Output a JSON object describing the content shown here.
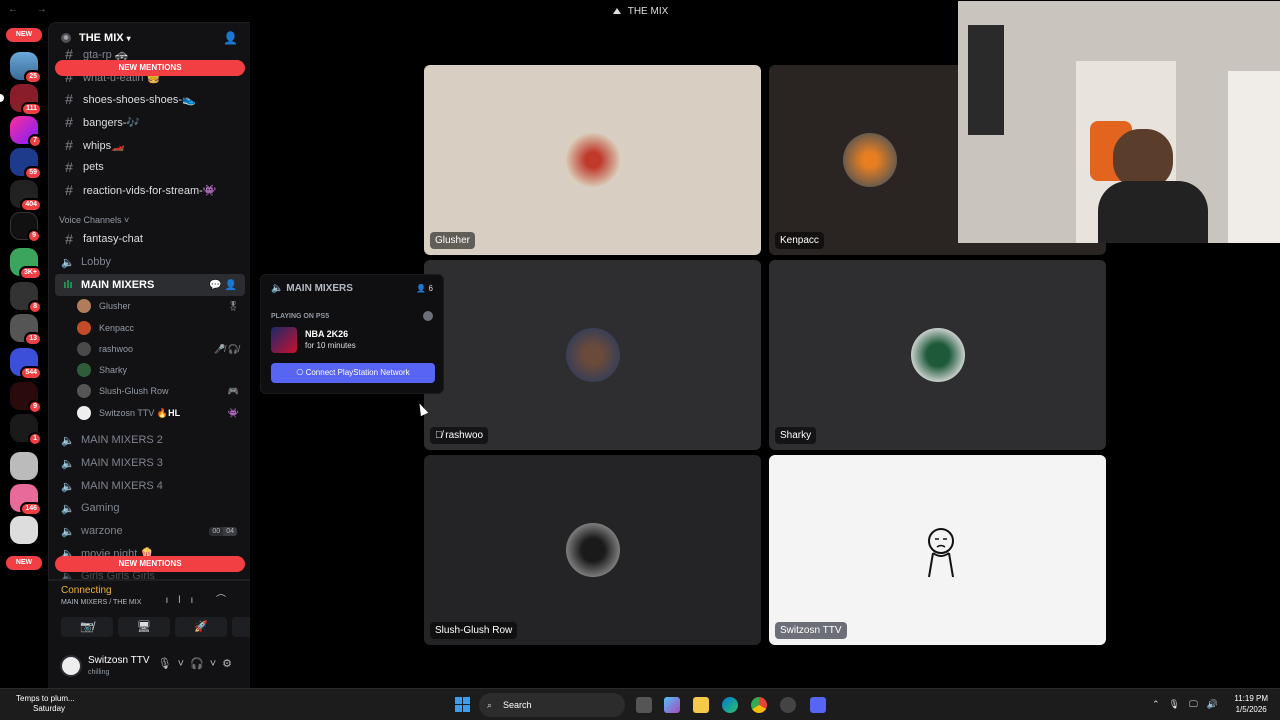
{
  "window": {
    "title": "THE MIX",
    "nav": "← →"
  },
  "rail": {
    "new_top": "NEW",
    "new_bottom": "NEW",
    "badges": [
      "25",
      "111",
      "7",
      "59",
      "404",
      "9",
      "3K+",
      "8",
      "13",
      "544",
      "9",
      "1",
      "146"
    ]
  },
  "sidebar": {
    "guild_name": "THE MIX",
    "mention_top": "NEW MENTIONS",
    "mention_bottom": "NEW MENTIONS",
    "text_channels": [
      {
        "name": "gta-rp 🚓"
      },
      {
        "name": "what-u-eatin 🍔"
      },
      {
        "name": "shoes-shoes-shoes-👟"
      },
      {
        "name": "bangers-🎶"
      },
      {
        "name": "whips🏎️"
      },
      {
        "name": "pets"
      },
      {
        "name": "reaction-vids-for-stream-👾"
      }
    ],
    "voice_category": "Voice Channels",
    "channels_after": [
      {
        "name": "fantasy-chat",
        "type": "text"
      },
      {
        "name": "Lobby",
        "type": "voice"
      },
      {
        "name": "MAIN MIXERS",
        "type": "voice",
        "active": true
      }
    ],
    "voice_users": [
      {
        "name": "Glusher",
        "color": "#b07c5a",
        "icon": "🎖"
      },
      {
        "name": "Kenpacc",
        "color": "#c24b2a",
        "icon": ""
      },
      {
        "name": "rashwoo",
        "color": "#4a4a4a",
        "icon": "🎤̸ 🎧̸"
      },
      {
        "name": "Sharky",
        "color": "#2f5d3a",
        "icon": ""
      },
      {
        "name": "Slush-Glush Row",
        "color": "#555",
        "icon": "🎮"
      },
      {
        "name": "Switzosn TTV",
        "color": "#eee",
        "icon": "👾",
        "tag": "🔥HL"
      }
    ],
    "more_channels": [
      {
        "name": "MAIN MIXERS 2"
      },
      {
        "name": "MAIN MIXERS 3"
      },
      {
        "name": "MAIN MIXERS 4"
      },
      {
        "name": "Gaming"
      },
      {
        "name": "warzone",
        "limit_a": "00",
        "limit_b": "04"
      },
      {
        "name": "movie night 🍿"
      },
      {
        "name": "Girls Girls Girls"
      }
    ]
  },
  "voice_panel": {
    "status": "Connecting",
    "location": "MAIN MIXERS / THE MIX",
    "buttons": [
      "📷̸",
      "🖥",
      "🚀",
      "✨"
    ],
    "user_name": "Switzosn TTV",
    "user_status": "chilling"
  },
  "hover_card": {
    "title": "MAIN MIXERS",
    "count": "6",
    "playing_label": "PLAYING ON PS5",
    "game": "NBA 2K26",
    "duration": "for 10 minutes",
    "button": "Connect PlayStation Network"
  },
  "tiles": [
    {
      "name": "Glusher",
      "bg": "#d8cec1"
    },
    {
      "name": "Kenpacc",
      "bg": "#2a2522"
    },
    {
      "name": "rashwoo",
      "bg": "#2e2e31",
      "muted": true
    },
    {
      "name": "Sharky",
      "bg": "#2e2e31"
    },
    {
      "name": "Slush-Glush Row",
      "bg": "#242426"
    },
    {
      "name": "Switzosn TTV",
      "bg": "#f4f4f4"
    }
  ],
  "taskbar": {
    "weather_line1": "Temps to plum...",
    "weather_line2": "Saturday",
    "search": "Search",
    "time": "11:19 PM",
    "date": "1/5/2026"
  },
  "colors": {
    "accent": "#5865f2",
    "danger": "#f23f43",
    "warning": "#f0b232"
  }
}
